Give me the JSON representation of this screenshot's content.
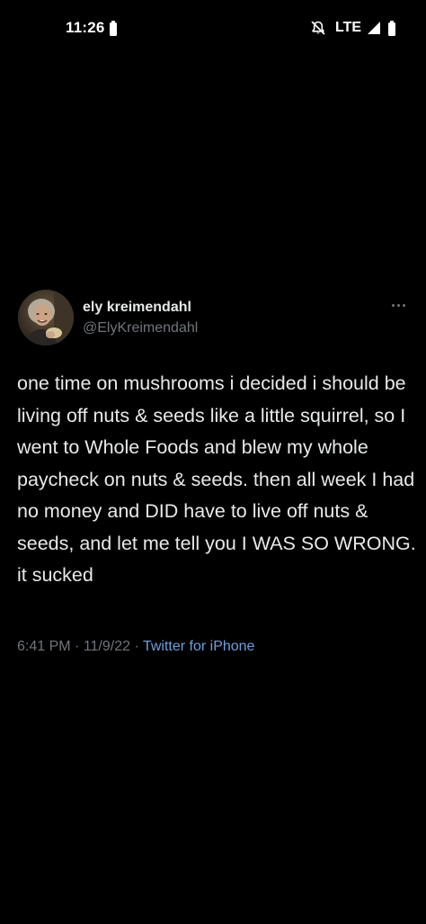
{
  "status_bar": {
    "time": "11:26",
    "network": "LTE",
    "icons": [
      "battery-icon",
      "mute-icon",
      "signal-icon",
      "battery-icon"
    ]
  },
  "tweet": {
    "author": {
      "name": "ely kreimendahl",
      "handle": "@ElyKreimendahl"
    },
    "more_icon": "more-horizontal-icon",
    "text": "one time on mushrooms i decided i should be living off nuts & seeds like a little squirrel, so I went to Whole Foods and blew my whole paycheck on nuts & seeds. then all week I had no money and DID have to live off nuts & seeds, and let me tell you I WAS SO WRONG. it sucked",
    "time": "6:41 PM",
    "separator_1": " · ",
    "date": "11/9/22",
    "separator_2": " · ",
    "source": "Twitter for iPhone"
  },
  "colors": {
    "background": "#000000",
    "primary_text": "#e7e9ea",
    "secondary_text": "#71767b",
    "link": "#6e9fd8"
  }
}
